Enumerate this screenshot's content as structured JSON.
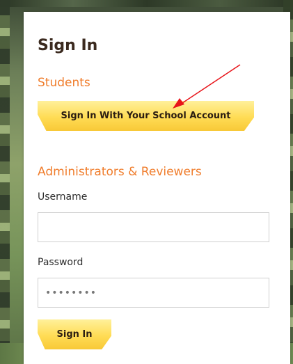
{
  "sign_in_card": {
    "title": "Sign In",
    "students": {
      "heading": "Students",
      "school_account_button": "Sign In With Your School Account"
    },
    "admins": {
      "heading": "Administrators & Reviewers",
      "username_label": "Username",
      "username_value": "",
      "password_label": "Password",
      "password_value": "••••••••",
      "sign_in_button": "Sign In"
    }
  },
  "colors": {
    "accent_orange": "#f07d2c",
    "button_yellow": "#ffdc55",
    "title_brown": "#3b2a1f",
    "annotation_arrow": "#e8141a"
  },
  "annotation": {
    "type": "red-arrow",
    "points_to": "school-account-sign-in-button"
  }
}
